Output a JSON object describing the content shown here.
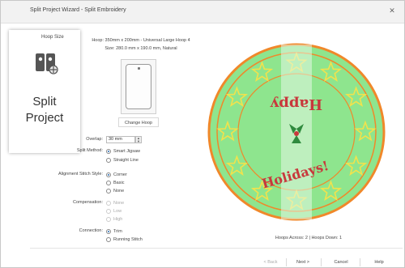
{
  "window": {
    "title": "Split Project Wizard - Split Embroidery"
  },
  "wizard_card": {
    "line1": "Split",
    "line2": "Project"
  },
  "hoop_group": {
    "label": "Hoop Size",
    "hoop_line": "Hoop: 350mm x 200mm - Universal Large Hoop 4",
    "size_line": "Size: 280.0 mm x 190.0 mm, Natural",
    "change_button": "Change Hoop"
  },
  "overlap": {
    "label": "Overlap:",
    "value": "30 mm"
  },
  "split_method": {
    "label": "Split Method:",
    "options": [
      {
        "label": "Smart Jigsaw",
        "checked": true,
        "disabled": false
      },
      {
        "label": "Straight Line",
        "checked": false,
        "disabled": false
      }
    ]
  },
  "alignment": {
    "label": "Alignment Stitch Style:",
    "options": [
      {
        "label": "Corner",
        "checked": true,
        "disabled": false
      },
      {
        "label": "Basic",
        "checked": false,
        "disabled": false
      },
      {
        "label": "None",
        "checked": false,
        "disabled": false
      }
    ]
  },
  "compensation": {
    "label": "Compensation:",
    "options": [
      {
        "label": "None",
        "checked": false,
        "disabled": true
      },
      {
        "label": "Low",
        "checked": false,
        "disabled": true
      },
      {
        "label": "High",
        "checked": false,
        "disabled": true
      }
    ]
  },
  "connection": {
    "label": "Connection:",
    "options": [
      {
        "label": "Trim",
        "checked": true,
        "disabled": false
      },
      {
        "label": "Running Stitch",
        "checked": false,
        "disabled": false
      }
    ]
  },
  "design": {
    "word1": "Happy",
    "word2": "Holidays!"
  },
  "status": {
    "text": "Hoops Across: 2 | Hoops Down: 1"
  },
  "buttons": {
    "back": "< Back",
    "next": "Next >",
    "cancel": "Cancel",
    "help": "Help"
  },
  "colors": {
    "fabric_green": "#8ee58e",
    "ring_orange": "#f0882a",
    "star_yellow": "#f2e24c",
    "text_red": "#c8383c",
    "split_band": "#e6f7e6"
  }
}
